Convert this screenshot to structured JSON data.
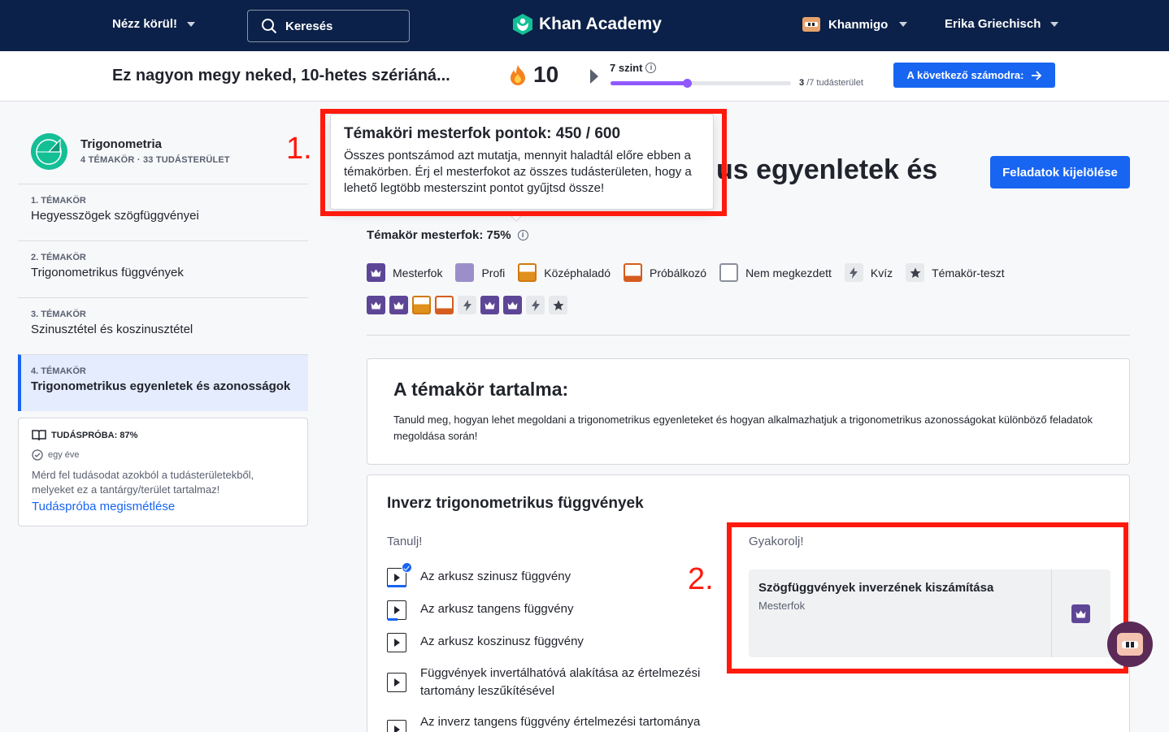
{
  "nav": {
    "explore": "Nézz körül!",
    "search_placeholder": "Keresés",
    "logo": "Khan Academy",
    "khanmigo": "Khanmigo",
    "user": "Erika Griechisch"
  },
  "streak": {
    "message": "Ez nagyon megy neked, 10-hetes szériáná...",
    "count": "10",
    "level": "7 szint",
    "level_progress": 0.43,
    "skills_done": "3",
    "skills_total": "/7 tudásterület",
    "next_button": "A következő számodra:"
  },
  "sidebar": {
    "course_title": "Trigonometria",
    "course_meta": "4 TÉMAKÖR · 33 TUDÁSTERÜLET",
    "units": [
      {
        "num": "1. TÉMAKÖR",
        "name": "Hegyesszögek szögfüggvényei"
      },
      {
        "num": "2. TÉMAKÖR",
        "name": "Trigonometrikus függvények"
      },
      {
        "num": "3. TÉMAKÖR",
        "name": "Szinusztétel és koszinusztétel"
      },
      {
        "num": "4. TÉMAKÖR",
        "name": "Trigonometrikus egyenletek és azonosságok"
      }
    ],
    "quiz": {
      "title": "TUDÁSPRÓBA: 87%",
      "ago": "egy éve",
      "desc": "Mérd fel tudásodat azokból a tudásterületekből, melyeket ez a tantárgy/terület tartalmaz!",
      "link": "Tudáspróba megismétlése"
    }
  },
  "main": {
    "heading_visible": "us egyenletek és",
    "assign_button": "Feladatok kijelölése",
    "mastery_label": "Témakör mesterfok: 75%",
    "legend": [
      "Mesterfok",
      "Profi",
      "Középhaladó",
      "Próbálkozó",
      "Nem megkezdett",
      "Kvíz",
      "Témakör-teszt"
    ],
    "progress_items": [
      "mastered",
      "mastered",
      "familiar",
      "attempted",
      "quiz",
      "mastered",
      "mastered",
      "quiz",
      "test"
    ],
    "about_title": "A témakör tartalma:",
    "about_desc": "Tanuld meg, hogyan lehet megoldani a trigonometrikus egyenleteket és hogyan alkalmazhatjuk a trigonometrikus azonosságokat különböző feladatok megoldása során!",
    "lesson_title": "Inverz trigonometrikus függvények",
    "learn_label": "Tanulj!",
    "practice_label": "Gyakorolj!",
    "videos": [
      "Az arkusz szinusz függvény",
      "Az arkusz tangens függvény",
      "Az arkusz koszinusz függvény",
      "Függvények invertálhatóvá alakítása az értelmezési tartomány leszűkítésével",
      "Az inverz tangens függvény értelmezési tartománya"
    ],
    "exercise_title": "Szögfüggvények inverzének kiszámítása",
    "exercise_status": "Mesterfok"
  },
  "tooltip": {
    "title": "Témaköri mesterfok pontok: 450 / 600",
    "text": "Összes pontszámod azt mutatja, mennyit haladtál előre ebben a témakörben. Érj el mesterfokot az összes tudásterületen, hogy a lehető legtöbb mesterszint pontot gyűjtsd össze!"
  },
  "annotations": {
    "one": "1.",
    "two": "2."
  },
  "colors": {
    "nav_bg": "#0b2149",
    "primary": "#1865f2",
    "mastered": "#5e4696",
    "annotation": "#ff1a0e"
  }
}
